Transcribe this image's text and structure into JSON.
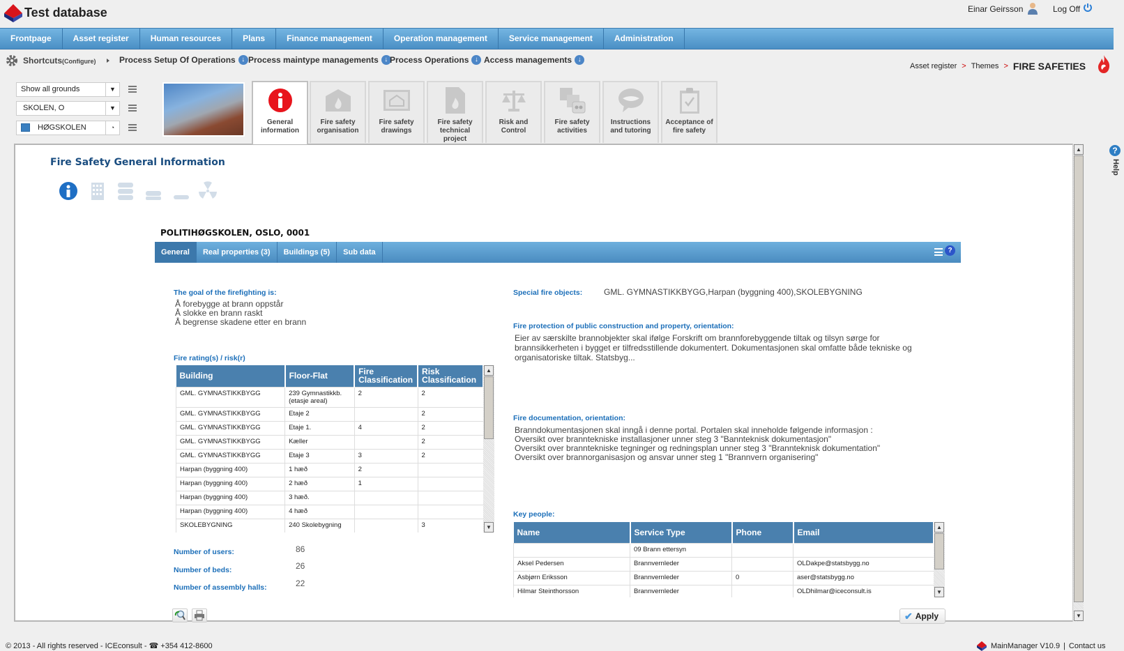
{
  "app": {
    "title": "Test database"
  },
  "user": {
    "name": "Einar Geirsson",
    "logoff": "Log Off"
  },
  "nav": {
    "items": [
      "Frontpage",
      "Asset register",
      "Human resources",
      "Plans",
      "Finance management",
      "Operation management",
      "Service management",
      "Administration"
    ]
  },
  "shortcuts": {
    "label": "Shortcuts",
    "configure": "(Configure)",
    "items": [
      "Process Setup Of Operations",
      "Process maintype managements",
      "Process Operations",
      "Access managements"
    ]
  },
  "breadcrumb": {
    "items": [
      "Asset register",
      "Themes"
    ],
    "current": "FIRE SAFETIES",
    "separator": ">"
  },
  "selectors": {
    "grounds": "Show all grounds",
    "site": "SKOLEN, O",
    "building": "HØGSKOLEN"
  },
  "theme_tabs": [
    {
      "label": "General information",
      "icon": "info-icon",
      "active": true
    },
    {
      "label": "Fire safety organisation",
      "icon": "fire-house-icon"
    },
    {
      "label": "Fire safety drawings",
      "icon": "house-drawing-icon"
    },
    {
      "label": "Fire safety technical project",
      "icon": "fire-document-icon"
    },
    {
      "label": "Risk and Control",
      "icon": "scales-icon"
    },
    {
      "label": "Fire safety activities",
      "icon": "activities-icon"
    },
    {
      "label": "Instructions and tutoring",
      "icon": "speech-bubble-icon"
    },
    {
      "label": "Acceptance of fire safety",
      "icon": "clipboard-check-icon"
    }
  ],
  "help": {
    "label": "Help"
  },
  "main": {
    "title": "Fire Safety General Information",
    "site_title": "POLITIHØGSKOLEN, OSLO, 0001",
    "subtabs": [
      "General",
      "Real properties (3)",
      "Buildings (5)",
      "Sub data"
    ],
    "goal": {
      "label": "The goal of the firefighting is:",
      "lines": [
        "Å forebygge at brann oppstår",
        "Å slokke en brann raskt",
        "Å begrense skadene etter en brann"
      ]
    },
    "ratings": {
      "label": "Fire rating(s) / risk(r)",
      "columns": [
        "Building",
        "Floor-Flat",
        "Fire Classification",
        "Risk Classification"
      ],
      "rows": [
        [
          "GML. GYMNASTIKKBYGG",
          "239 Gymnastikkb. (etasje areal)",
          "2",
          "2"
        ],
        [
          "GML. GYMNASTIKKBYGG",
          "Etaje 2",
          "",
          "2"
        ],
        [
          "GML. GYMNASTIKKBYGG",
          "Etaje 1.",
          "4",
          "2"
        ],
        [
          "GML. GYMNASTIKKBYGG",
          "Kæller",
          "",
          "2"
        ],
        [
          "GML. GYMNASTIKKBYGG",
          "Etaje 3",
          "3",
          "2"
        ],
        [
          "Harpan (byggning 400)",
          "1 hæð",
          "2",
          ""
        ],
        [
          "Harpan (byggning 400)",
          "2 hæð",
          "1",
          ""
        ],
        [
          "Harpan (byggning 400)",
          "3 hæð.",
          "",
          ""
        ],
        [
          "Harpan (byggning 400)",
          "4 hæð",
          "",
          ""
        ],
        [
          "SKOLEBYGNING",
          "240 Skolebygning",
          "",
          "3"
        ]
      ]
    },
    "stats": [
      {
        "label": "Number of users:",
        "value": "86"
      },
      {
        "label": "Number of beds:",
        "value": "26"
      },
      {
        "label": "Number of assembly halls:",
        "value": "22"
      }
    ],
    "special": {
      "label": "Special fire objects:",
      "value": "GML. GYMNASTIKKBYGG,Harpan (byggning 400),SKOLEBYGNING"
    },
    "protection": {
      "label": "Fire protection of public construction and property, orientation:",
      "text": "Eier av særskilte brannobjekter skal ifølge Forskrift om brannforebyggende tiltak og tilsyn sørge for brannsikkerheten i bygget er tilfredsstillende dokumentert. Dokumentasjonen skal omfatte både tekniske og organisatoriske tiltak. Statsbyg..."
    },
    "documentation": {
      "label": "Fire documentation, orientation:",
      "lines": [
        "Branndokumentasjonen skal inngå i denne portal. Portalen skal inneholde følgende informasjon :",
        "Oversikt over branntekniske installasjoner unner steg 3 \"Bannteknisk dokumentasjon\"",
        "Oversikt over branntekniske tegninger og redningsplan unner steg 3 \"Brannteknisk dokumentation\"",
        "Oversikt over brannorganisasjon og ansvar unner steg 1 \"Brannvern organisering\""
      ]
    },
    "key_people": {
      "label": "Key people:",
      "columns": [
        "Name",
        "Service Type",
        "Phone",
        "Email"
      ],
      "rows": [
        [
          "",
          "09 Brann ettersyn",
          "",
          ""
        ],
        [
          "Aksel Pedersen",
          "Brannvernleder",
          "",
          "OLDakpe@statsbygg.no"
        ],
        [
          "Asbjørn Eriksson",
          "Brannvernleder",
          "0",
          "aser@statsbygg.no"
        ],
        [
          "Hilmar Steinthorsson",
          "Brannvernleder",
          "",
          "OLDhilmar@iceconsult.is"
        ]
      ]
    },
    "apply": "Apply"
  },
  "footer": {
    "left": "© 2013 - All rights reserved - ICEconsult - ☎ +354 412-8600",
    "version": "MainManager V10.9",
    "separator": "|",
    "contact": "Contact us"
  }
}
